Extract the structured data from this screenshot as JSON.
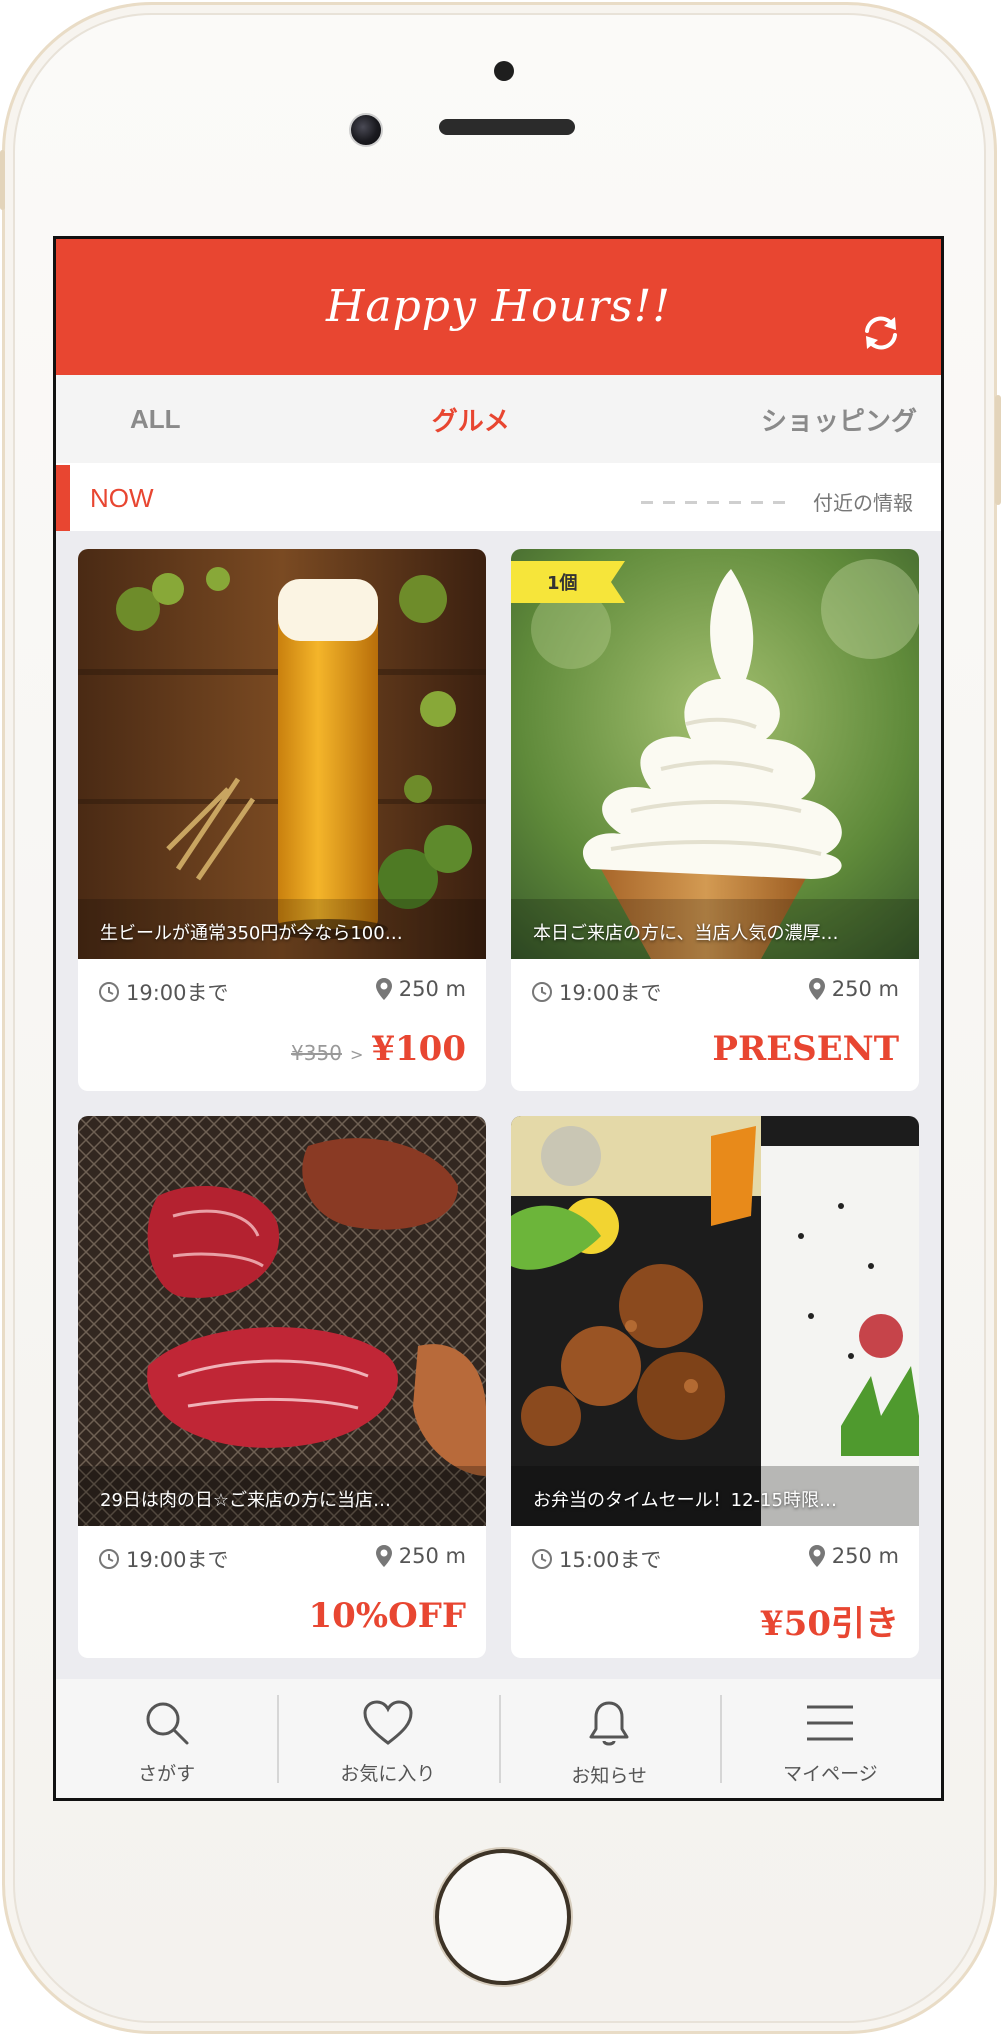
{
  "app": {
    "logo_text": "Happy Hours!!",
    "brand_color": "#e84631"
  },
  "tabs": [
    {
      "label": "ALL",
      "active": false
    },
    {
      "label": "グルメ",
      "active": true
    },
    {
      "label": "ショッピング",
      "active": false
    }
  ],
  "now_bar": {
    "now_label": "NOW",
    "nearby_label": "付近の情報"
  },
  "cards": [
    {
      "image": "beer-glass",
      "caption": "生ビールが通常350円が今なら100…",
      "time": "19:00まで",
      "distance": "250 m",
      "old_price": "¥350",
      "price_arrow": ">",
      "deal": "¥100"
    },
    {
      "image": "soft-serve",
      "badge": "1個",
      "caption": "本日ご来店の方に、当店人気の濃厚…",
      "time": "19:00まで",
      "distance": "250 m",
      "deal": "PRESENT"
    },
    {
      "image": "yakiniku",
      "caption": "29日は肉の日☆ご来店の方に当店…",
      "time": "19:00まで",
      "distance": "250 m",
      "deal": "10%OFF"
    },
    {
      "image": "bento",
      "caption": "お弁当のタイムセール！12-15時限…",
      "time": "15:00まで",
      "distance": "250 m",
      "deal": "¥50引き"
    }
  ],
  "bottom_nav": [
    {
      "label": "さがす",
      "icon": "search-icon"
    },
    {
      "label": "お気に入り",
      "icon": "heart-icon"
    },
    {
      "label": "お知らせ",
      "icon": "bell-icon"
    },
    {
      "label": "マイページ",
      "icon": "menu-icon"
    }
  ]
}
